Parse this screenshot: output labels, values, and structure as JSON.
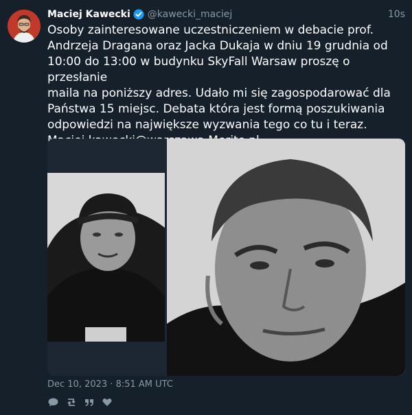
{
  "author": {
    "name": "Maciej Kawecki",
    "handle": "@kawecki_maciej",
    "verified": true,
    "avatar_icon": "user-avatar"
  },
  "tweet": {
    "time_ago": "10s",
    "text": "Osoby zainteresowane uczestniczeniem w debacie prof.\nAndrzeja Dragana oraz Jacka Dukaja w dniu 19 grudnia od\n10:00 do 13:00 w budynku SkyFall Warsaw proszę o przesłanie\nmaila na poniższy adres. Udało mi się zagospodarować dla\nPaństwa 15 miejsc. Debata która jest formą poszukiwania\nodpowiedzi na największe wyzwania tego co tu i teraz.\nMaciej.kawecki@warszawa.Merito.pl",
    "timestamp": "Dec 10, 2023 · 8:51 AM UTC"
  },
  "media": {
    "left_photo": "portrait-man-cap",
    "right_photo": "portrait-man-closeup"
  },
  "actions": [
    {
      "name": "reply",
      "icon": "reply-icon"
    },
    {
      "name": "retweet",
      "icon": "retweet-icon"
    },
    {
      "name": "quote",
      "icon": "quote-icon"
    },
    {
      "name": "like",
      "icon": "heart-icon"
    }
  ],
  "colors": {
    "background": "#15202b",
    "secondary_text": "#8899a6",
    "verified_blue": "#1d9bf0"
  }
}
